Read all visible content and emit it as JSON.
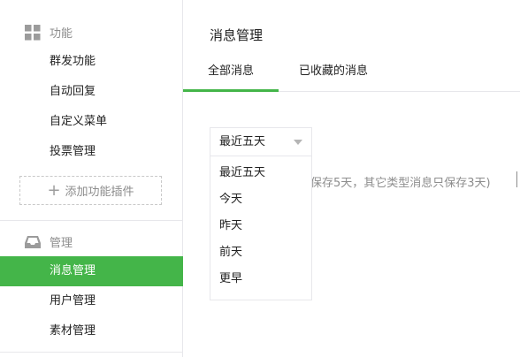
{
  "sidebar": {
    "sections": [
      {
        "title": "功能",
        "icon": "grid-icon",
        "items": [
          "群发功能",
          "自动回复",
          "自定义菜单",
          "投票管理"
        ]
      },
      {
        "title": "管理",
        "icon": "inbox-tray-icon",
        "items": [
          "消息管理",
          "用户管理",
          "素材管理"
        ]
      }
    ],
    "add_plugin_label": "添加功能插件",
    "active_item": "消息管理"
  },
  "main": {
    "title": "消息管理",
    "tabs": [
      {
        "label": "全部消息",
        "active": true
      },
      {
        "label": "已收藏的消息",
        "active": false
      }
    ],
    "filter": {
      "selected": "最近五天",
      "options": [
        "最近五天",
        "今天",
        "昨天",
        "前天",
        "更早"
      ]
    },
    "note": "保存5天，其它类型消息只保存3天)"
  },
  "colors": {
    "accent": "#44b549",
    "muted_text": "#8d8d8d",
    "border": "#e7e7eb"
  }
}
